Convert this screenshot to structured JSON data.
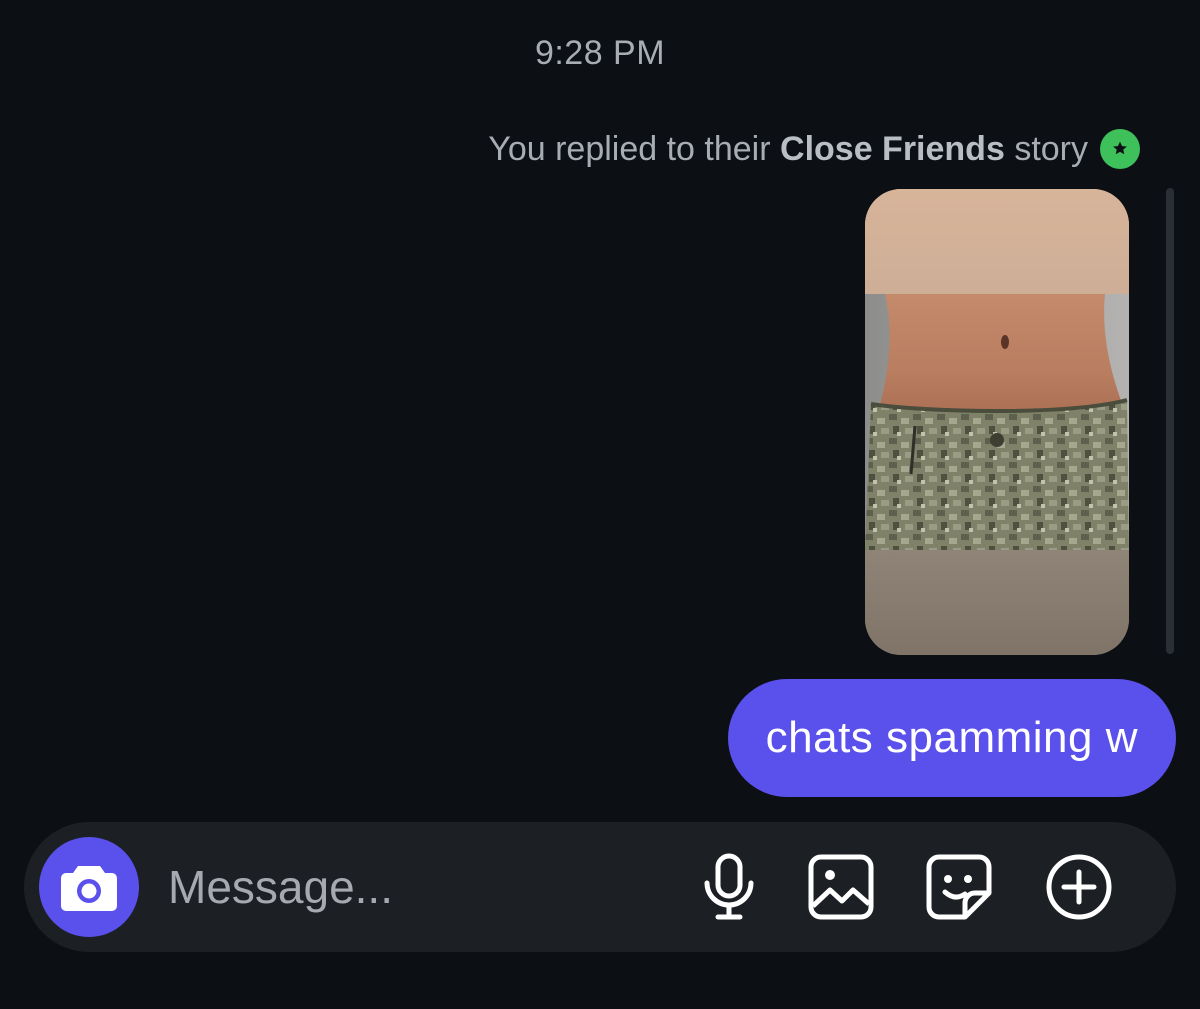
{
  "thread": {
    "timestamp": "9:28 PM",
    "reply_note": {
      "prefix": "You replied to their",
      "highlight": "Close Friends",
      "suffix": "story"
    },
    "badge_icon": "green-star-badge-icon",
    "story_preview_icon": "story-photo-thumbnail",
    "sent_message": "chats spamming w"
  },
  "composer": {
    "camera_icon": "camera-icon",
    "placeholder": "Message...",
    "tools": [
      "microphone-icon",
      "gallery-icon",
      "sticker-icon",
      "plus-circle-icon"
    ]
  },
  "colors": {
    "background": "#0c1014",
    "accent": "#5a50ec",
    "badge": "#3ec15a",
    "muted_text": "#a8acb3",
    "composer_bg": "#1c2024"
  }
}
